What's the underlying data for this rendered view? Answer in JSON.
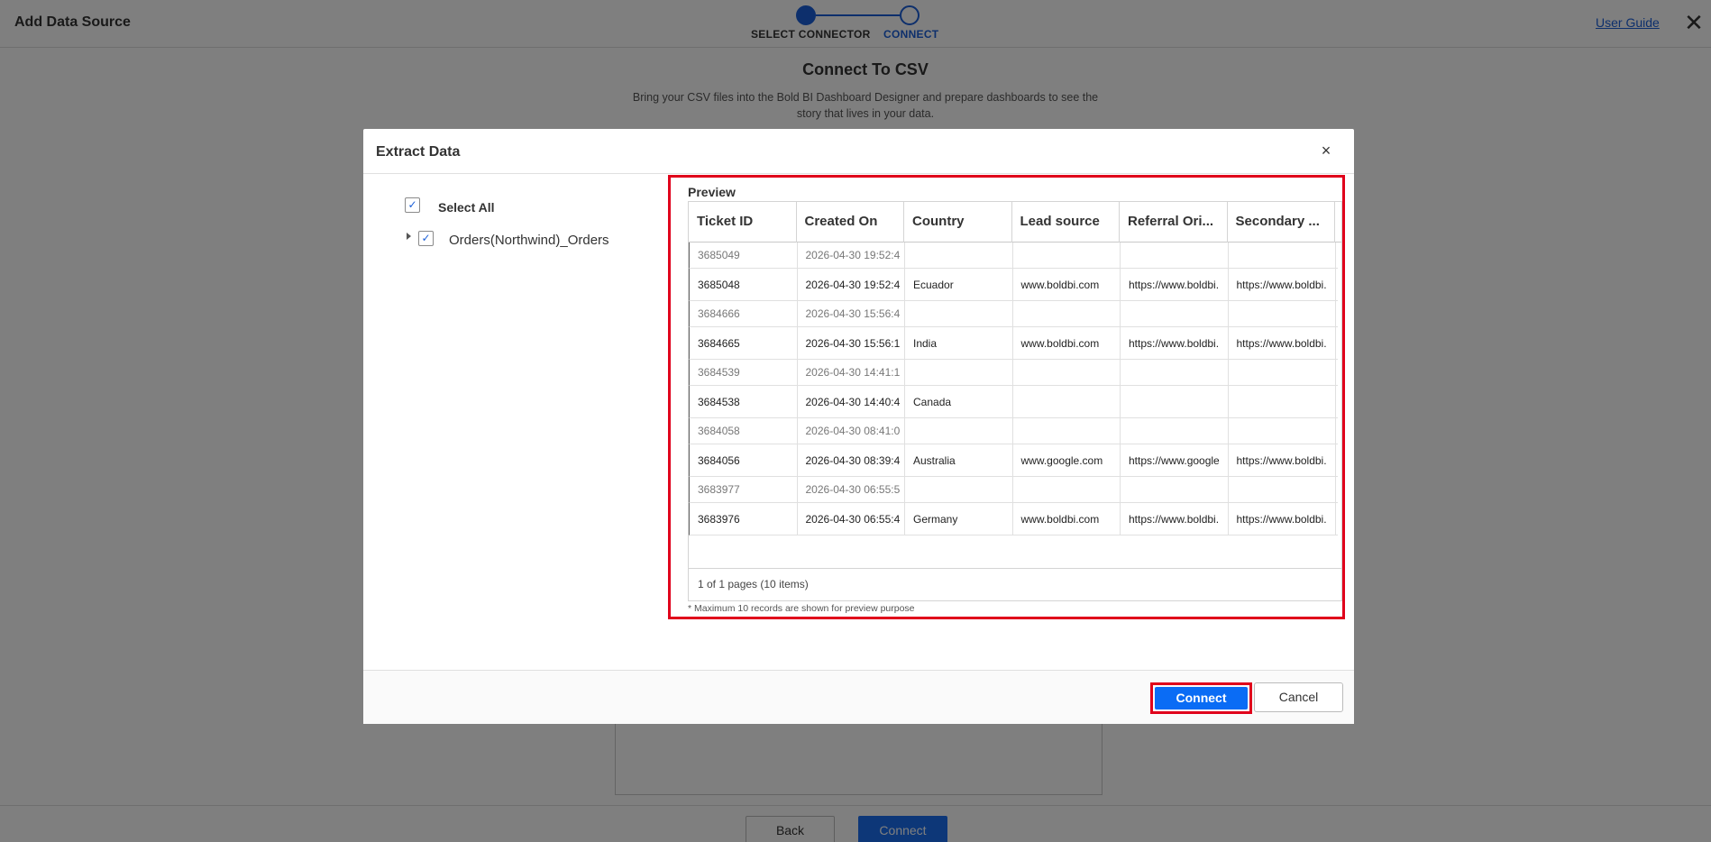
{
  "app": {
    "title": "Add Data Source",
    "steps": [
      {
        "label": "SELECT CONNECTOR",
        "state": "done"
      },
      {
        "label": "CONNECT",
        "state": "active"
      }
    ],
    "user_guide": "User Guide",
    "close_glyph": "✕"
  },
  "page": {
    "heading": "Connect To CSV",
    "description": "Bring your CSV files into the Bold BI Dashboard Designer and prepare dashboards to see the story that lives in your data.",
    "back_label": "Back",
    "connect_label": "Connect"
  },
  "modal": {
    "title": "Extract Data",
    "close_glyph": "×",
    "tree": {
      "select_all_label": "Select All",
      "select_all_checked": true,
      "node_label": "Orders(Northwind)_Orders",
      "node_checked": true
    },
    "preview": {
      "title": "Preview",
      "columns": [
        "Ticket ID",
        "Created On",
        "Country",
        "Lead source",
        "Referral Ori...",
        "Secondary ..."
      ],
      "rows": [
        [
          "3685049",
          "2026-04-30 19:52:4",
          "",
          "",
          "",
          ""
        ],
        [
          "3685048",
          "2026-04-30 19:52:4",
          "Ecuador",
          "www.boldbi.com",
          "https://www.boldbi.",
          "https://www.boldbi."
        ],
        [
          "3684666",
          "2026-04-30 15:56:4",
          "",
          "",
          "",
          ""
        ],
        [
          "3684665",
          "2026-04-30 15:56:1",
          "India",
          "www.boldbi.com",
          "https://www.boldbi.",
          "https://www.boldbi."
        ],
        [
          "3684539",
          "2026-04-30 14:41:1",
          "",
          "",
          "",
          ""
        ],
        [
          "3684538",
          "2026-04-30 14:40:4",
          "Canada",
          "",
          "",
          ""
        ],
        [
          "3684058",
          "2026-04-30 08:41:0",
          "",
          "",
          "",
          ""
        ],
        [
          "3684056",
          "2026-04-30 08:39:4",
          "Australia",
          "www.google.com",
          "https://www.google",
          "https://www.boldbi."
        ],
        [
          "3683977",
          "2026-04-30 06:55:5",
          "",
          "",
          "",
          ""
        ],
        [
          "3683976",
          "2026-04-30 06:55:4",
          "Germany",
          "www.boldbi.com",
          "https://www.boldbi.",
          "https://www.boldbi."
        ]
      ],
      "pager": "1 of 1 pages (10 items)",
      "footnote": "* Maximum 10 records are shown for preview purpose"
    },
    "connect_label": "Connect",
    "cancel_label": "Cancel"
  },
  "colors": {
    "accent": "#1a5fd8",
    "primary_button": "#0a6cf5",
    "highlight": "#e0001b"
  }
}
